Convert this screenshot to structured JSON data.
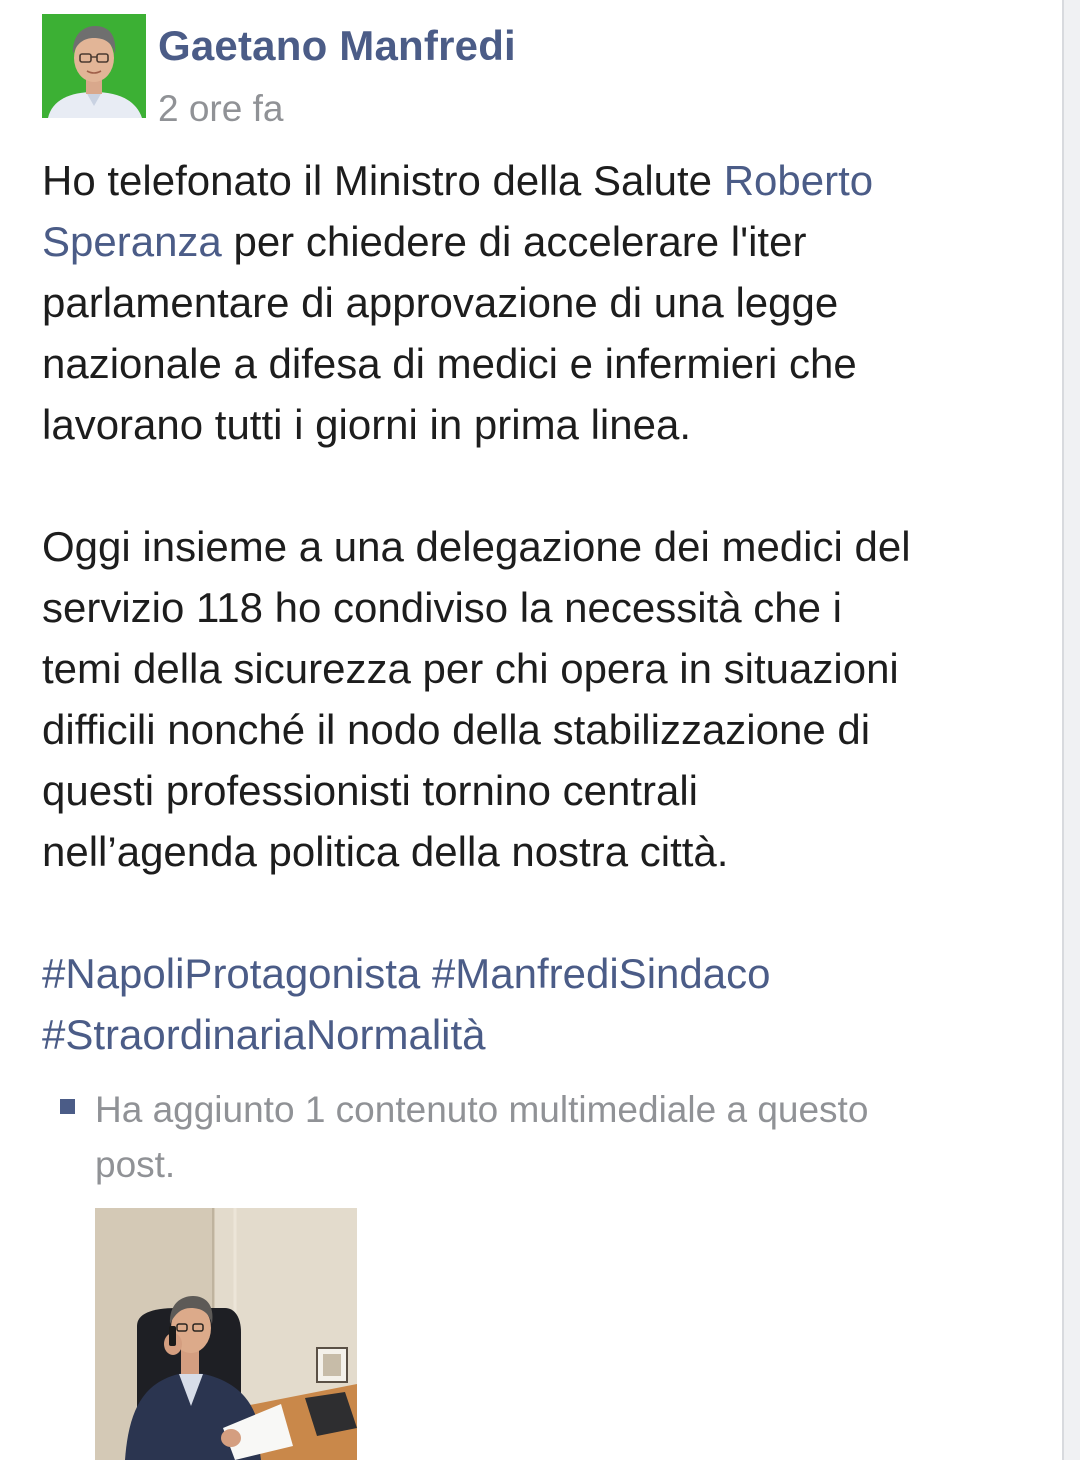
{
  "post": {
    "author": "Gaetano Manfredi",
    "time": "2 ore fa",
    "lines": {
      "l1_text": "Ho telefonato il Ministro della Salute ",
      "l1_link": "Roberto",
      "l2_link": "Speranza",
      "l2_text": " per chiedere di accelerare l'iter",
      "l3": "parlamentare di approvazione di una legge",
      "l4": "nazionale a difesa di medici e infermieri che",
      "l5": "lavorano tutti i giorni in prima linea.",
      "l6": "Oggi insieme a una delegazione dei medici del",
      "l7": "servizio 118 ho condiviso la necessità che i",
      "l8": "temi della sicurezza per chi opera in situazioni",
      "l9": "difficili nonché il nodo della stabilizzazione di",
      "l10": "questi professionisti tornino centrali",
      "l11": "nell’agenda politica della nostra città."
    },
    "hashtags": {
      "tag1": "#NapoliProtagonista",
      "tag2": "#ManfrediSindaco",
      "tag3": "#StraordinariaNormalità"
    },
    "media_note": {
      "line1": "Ha aggiunto 1 contenuto multimediale a questo",
      "line2": "post."
    }
  },
  "colors": {
    "link": "#4b5c87",
    "avatar_bg": "#3cb034",
    "meta_gray": "#909296",
    "text": "#1d1d1d"
  },
  "icons": {
    "avatar": "profile-photo",
    "bullet": "square-bullet-icon",
    "photo": "post-photo-thumbnail"
  }
}
